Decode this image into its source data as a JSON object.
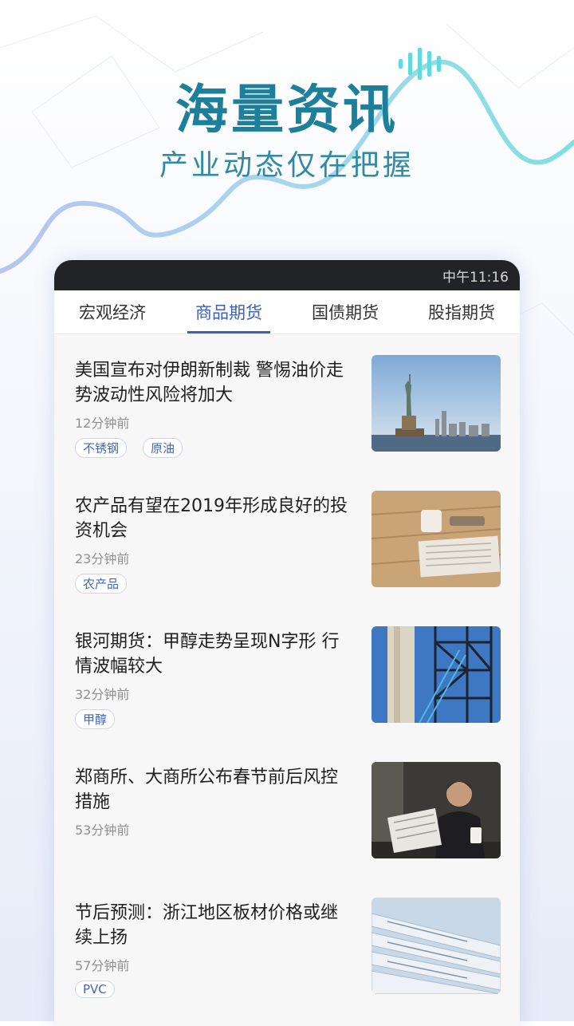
{
  "hero": {
    "title": "海量资讯",
    "subtitle": "产业动态仅在把握"
  },
  "status_bar": {
    "time": "中午11:16"
  },
  "tabs": [
    {
      "label": "宏观经济",
      "active": false
    },
    {
      "label": "商品期货",
      "active": true
    },
    {
      "label": "国债期货",
      "active": false
    },
    {
      "label": "股指期货",
      "active": false
    }
  ],
  "news": [
    {
      "title": "美国宣布对伊朗新制裁 警惕油价走势波动性风险将加大",
      "time": "12分钟前",
      "tags": [
        "不锈钢",
        "原油"
      ],
      "image": "statue-of-liberty-image"
    },
    {
      "title": "农产品有望在2019年形成良好的投资机会",
      "time": "23分钟前",
      "tags": [
        "农产品"
      ],
      "image": "newspaper-table-image"
    },
    {
      "title": "银河期货：甲醇走势呈现N字形 行情波幅较大",
      "time": "32分钟前",
      "tags": [
        "甲醇"
      ],
      "image": "industrial-tower-image"
    },
    {
      "title": "郑商所、大商所公布春节前后风控措施",
      "time": "53分钟前",
      "tags": [],
      "image": "man-reading-newspaper-image"
    },
    {
      "title": "节后预测：浙江地区板材价格或继续上扬",
      "time": "57分钟前",
      "tags": [
        "PVC"
      ],
      "image": "newspaper-stack-image"
    }
  ]
}
